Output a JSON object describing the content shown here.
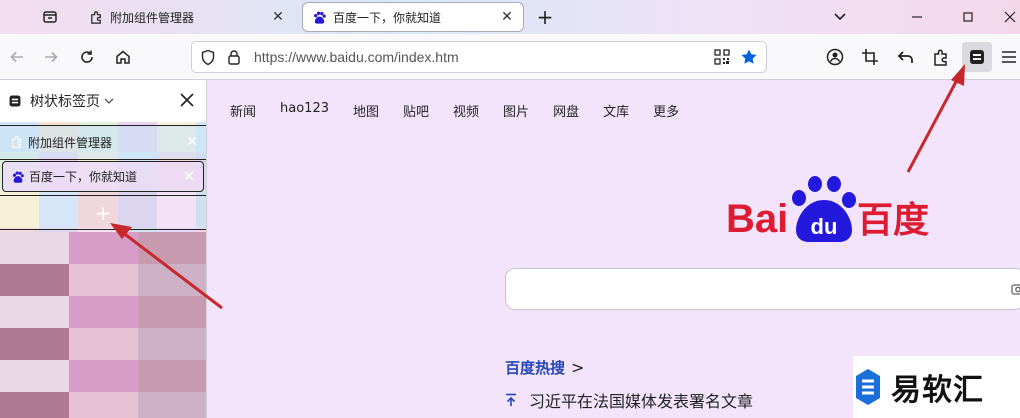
{
  "colors": {
    "accent": "#0061e0",
    "baidu_red": "#de1c31",
    "baidu_blue": "#2319dc",
    "annotation_red": "#c7282b"
  },
  "tabs": [
    {
      "label": "附加组件管理器",
      "icon": "puzzle-icon"
    },
    {
      "label": "百度一下，你就知道",
      "icon": "baidu-paw-icon",
      "active": true
    }
  ],
  "toolbar": {
    "new_tab": "+",
    "url": "https://www.baidu.com/index.htm",
    "icons": [
      "back-icon",
      "forward-icon",
      "reload-icon",
      "home-icon",
      "shield-icon",
      "lock-icon",
      "qr-code-icon",
      "star-icon",
      "account-icon",
      "crop-icon",
      "undo-icon",
      "extensions-icon",
      "tree-tabs-icon",
      "menu-icon"
    ]
  },
  "sidebar": {
    "title": "树状标签页",
    "items": [
      {
        "label": "附加组件管理器"
      },
      {
        "label": "百度一下，你就知道"
      }
    ],
    "new_tab": "+"
  },
  "page": {
    "nav_links": [
      "新闻",
      "hao123",
      "地图",
      "贴吧",
      "视频",
      "图片",
      "网盘",
      "文库",
      "更多"
    ],
    "logo": {
      "left": "Bai",
      "paw": "du",
      "right": "百度"
    },
    "hot_title": "百度热搜",
    "hot_arrow": ">",
    "hot_item": "习近平在法国媒体发表署名文章"
  },
  "watermark": {
    "text": "易软汇"
  }
}
